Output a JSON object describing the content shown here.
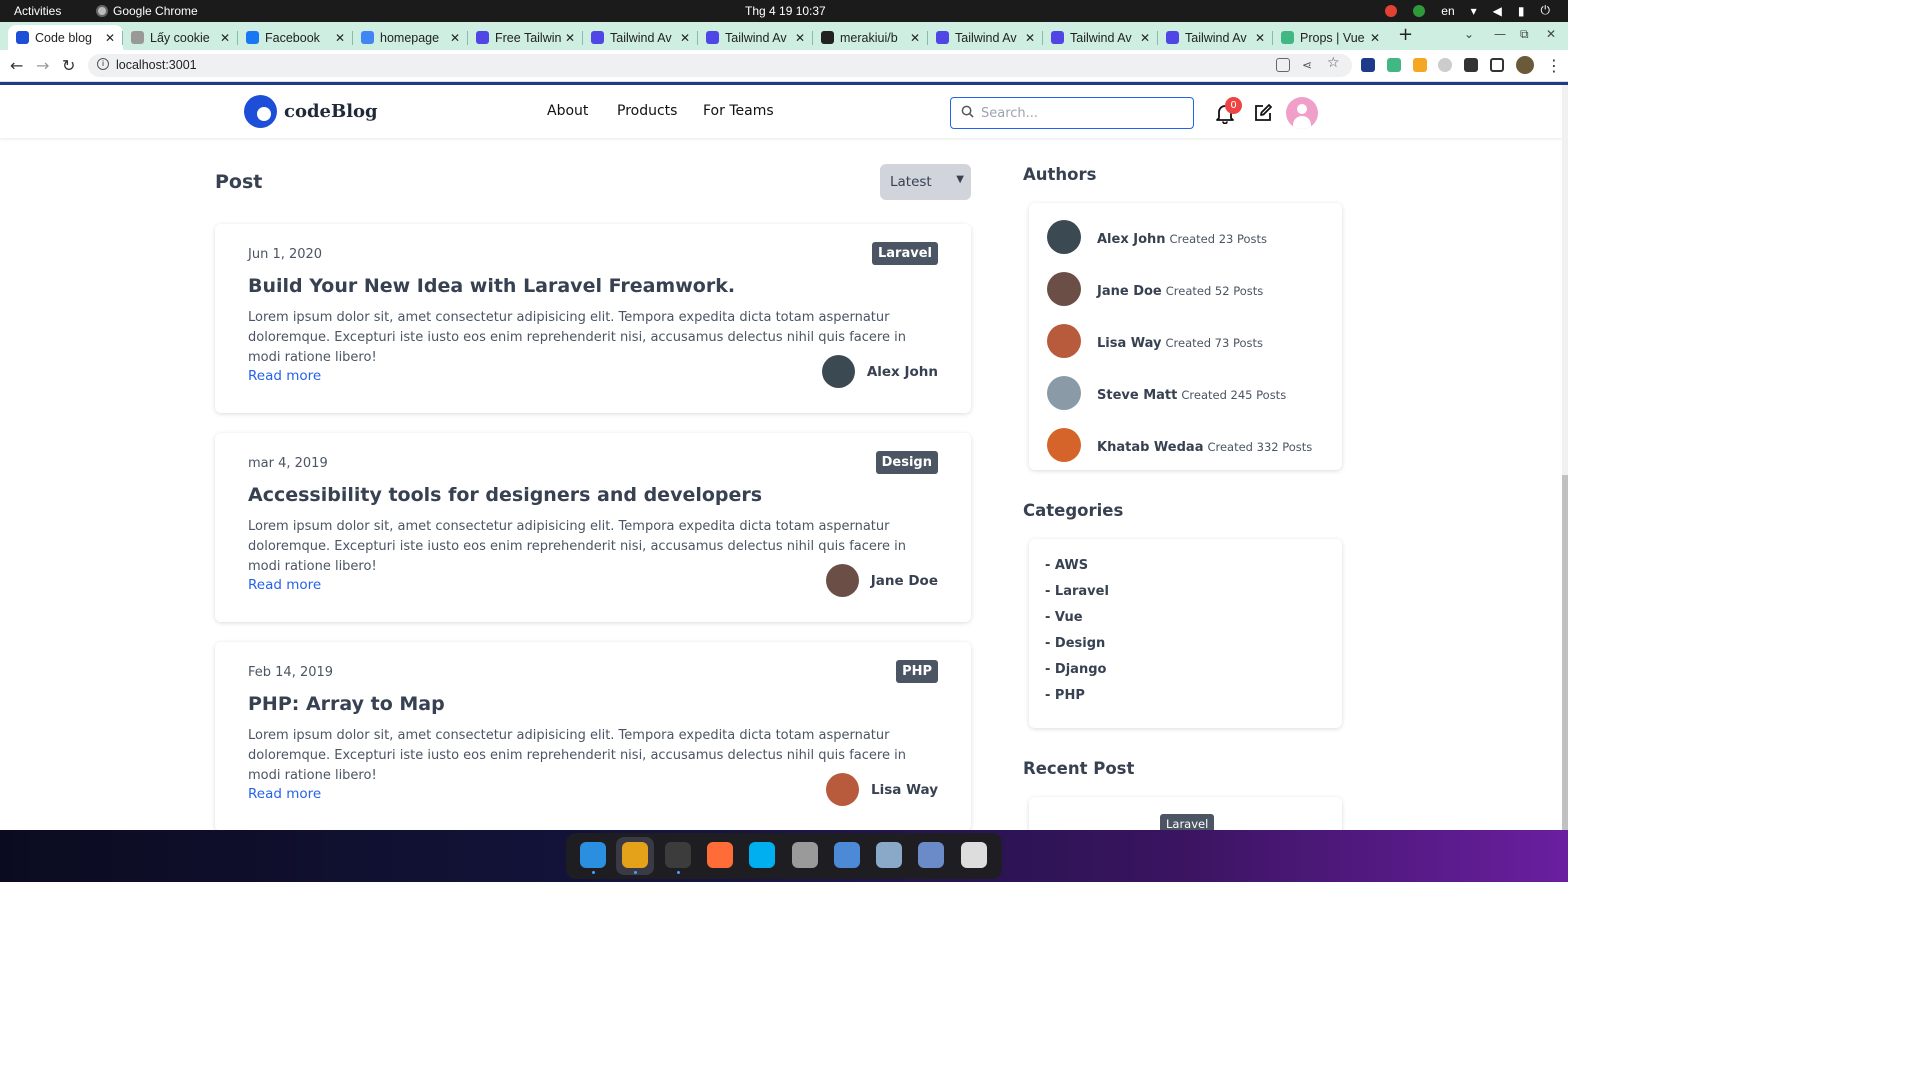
{
  "os": {
    "activities": "Activities",
    "app_name": "Google Chrome",
    "clock": "Thg 4 19  10:37",
    "language": "en"
  },
  "browser": {
    "tabs": [
      {
        "title": "Code blog",
        "favicon_color": "#1d4ed8"
      },
      {
        "title": "Lấy cookie",
        "favicon_color": "#999999"
      },
      {
        "title": "Facebook",
        "favicon_color": "#1877f2"
      },
      {
        "title": "homepage",
        "favicon_color": "#4285f4"
      },
      {
        "title": "Free Tailwind",
        "favicon_color": "#4f46e5"
      },
      {
        "title": "Tailwind Av",
        "favicon_color": "#4f46e5"
      },
      {
        "title": "Tailwind Av",
        "favicon_color": "#4f46e5"
      },
      {
        "title": "merakiui/b",
        "favicon_color": "#222222"
      },
      {
        "title": "Tailwind Av",
        "favicon_color": "#4f46e5"
      },
      {
        "title": "Tailwind Av",
        "favicon_color": "#4f46e5"
      },
      {
        "title": "Tailwind Av",
        "favicon_color": "#4f46e5"
      },
      {
        "title": "Props | Vue",
        "favicon_color": "#41b883"
      }
    ],
    "url": "localhost:3001"
  },
  "site": {
    "logo_text": "codeBlog",
    "nav": [
      "About",
      "Products",
      "For Teams"
    ],
    "search_placeholder": "Search...",
    "notification_count": "0",
    "accent_color": "#1d4ed8"
  },
  "main": {
    "heading": "Post",
    "sort_value": "Latest",
    "read_more": "Read more",
    "posts": [
      {
        "date": "Jun 1, 2020",
        "tag": "Laravel",
        "title": "Build Your New Idea with Laravel Freamwork.",
        "excerpt": "Lorem ipsum dolor sit, amet consectetur adipisicing elit. Tempora expedita dicta totam aspernatur doloremque. Excepturi iste iusto eos enim reprehenderit nisi, accusamus delectus nihil quis facere in modi ratione libero!",
        "author": "Alex John",
        "avatar_color": "#3b4a52"
      },
      {
        "date": "mar 4, 2019",
        "tag": "Design",
        "title": "Accessibility tools for designers and developers",
        "excerpt": "Lorem ipsum dolor sit, amet consectetur adipisicing elit. Tempora expedita dicta totam aspernatur doloremque. Excepturi iste iusto eos enim reprehenderit nisi, accusamus delectus nihil quis facere in modi ratione libero!",
        "author": "Jane Doe",
        "avatar_color": "#6b4f46"
      },
      {
        "date": "Feb 14, 2019",
        "tag": "PHP",
        "title": "PHP: Array to Map",
        "excerpt": "Lorem ipsum dolor sit, amet consectetur adipisicing elit. Tempora expedita dicta totam aspernatur doloremque. Excepturi iste iusto eos enim reprehenderit nisi, accusamus delectus nihil quis facere in modi ratione libero!",
        "author": "Lisa Way",
        "avatar_color": "#b85a3c"
      }
    ]
  },
  "sidebar": {
    "authors_heading": "Authors",
    "authors": [
      {
        "name": "Alex John",
        "count": "Created 23 Posts",
        "avatar_color": "#3b4a52"
      },
      {
        "name": "Jane Doe",
        "count": "Created 52 Posts",
        "avatar_color": "#6b4f46"
      },
      {
        "name": "Lisa Way",
        "count": "Created 73 Posts",
        "avatar_color": "#b85a3c"
      },
      {
        "name": "Steve Matt",
        "count": "Created 245 Posts",
        "avatar_color": "#8a9aa6"
      },
      {
        "name": "Khatab Wedaa",
        "count": "Created 332 Posts",
        "avatar_color": "#d4642a"
      }
    ],
    "categories_heading": "Categories",
    "categories": [
      "- AWS",
      "- Laravel",
      "- Vue",
      "- Design",
      "- Django",
      "- PHP"
    ],
    "recent_heading": "Recent Post",
    "recent_tag": "Laravel"
  },
  "dock": {
    "apps": [
      {
        "name": "vscode-icon",
        "color": "#2b8fe0"
      },
      {
        "name": "chrome-icon",
        "color": "#e3a21a"
      },
      {
        "name": "terminal-icon",
        "color": "#3c3c3c"
      },
      {
        "name": "postman-icon",
        "color": "#ff6c37"
      },
      {
        "name": "skype-icon",
        "color": "#00aff0"
      },
      {
        "name": "settings-icon",
        "color": "#9a9a9a"
      },
      {
        "name": "thunderbird-icon",
        "color": "#4c8ad8"
      },
      {
        "name": "files-icon",
        "color": "#8aa9c8"
      },
      {
        "name": "text-editor-icon",
        "color": "#6b8ac8"
      },
      {
        "name": "apps-grid-icon",
        "color": "#dddddd"
      }
    ]
  }
}
